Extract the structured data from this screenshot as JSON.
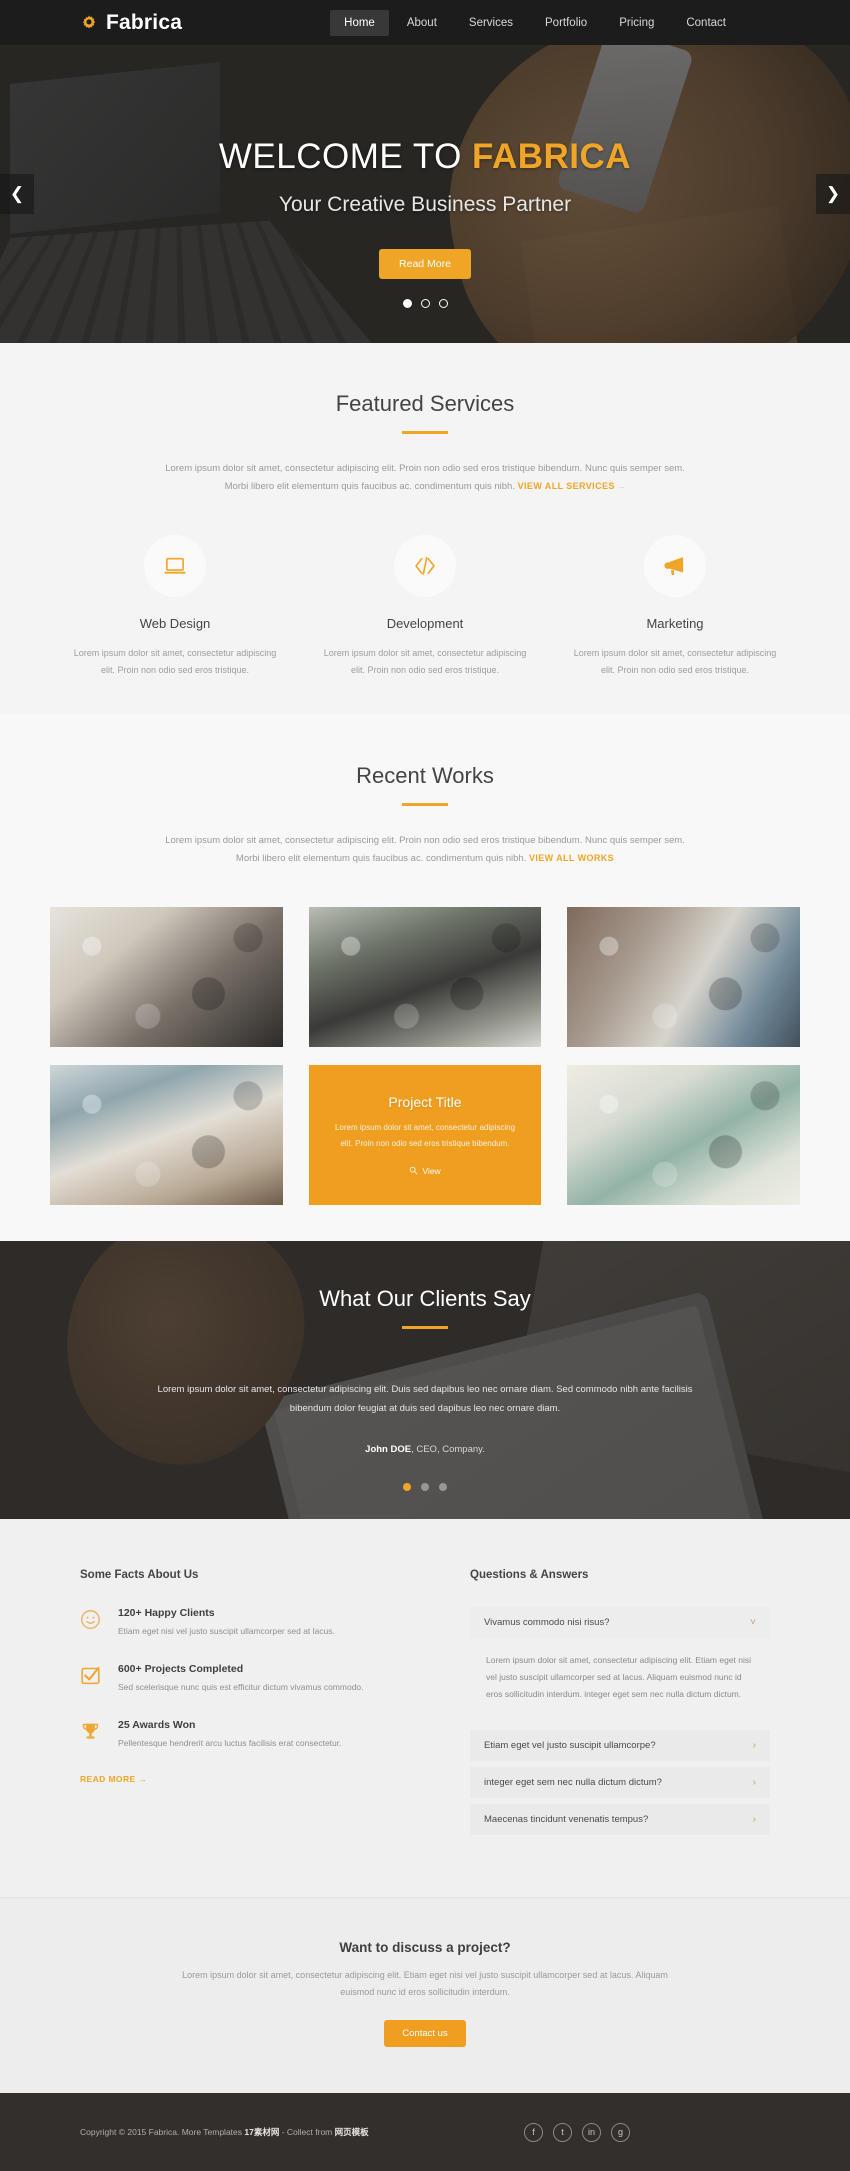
{
  "header": {
    "brand": "Fabrica",
    "brand_icon": "gear-icon",
    "nav": [
      {
        "label": "Home",
        "active": true
      },
      {
        "label": "About",
        "active": false
      },
      {
        "label": "Services",
        "active": false
      },
      {
        "label": "Portfolio",
        "active": false
      },
      {
        "label": "Pricing",
        "active": false
      },
      {
        "label": "Contact",
        "active": false
      }
    ]
  },
  "hero": {
    "title_main": "WELCOME TO ",
    "title_accent": "FABRICA",
    "subtitle": "Your Creative Business Partner",
    "button": "Read More",
    "prev_icon": "chevron-left-icon",
    "next_icon": "chevron-right-icon",
    "slide_count": 3,
    "active_slide": 1
  },
  "services": {
    "title": "Featured Services",
    "description": "Lorem ipsum dolor sit amet, consectetur adipiscing elit. Proin non odio sed eros tristique bibendum. Nunc quis semper sem. Morbi libero elit elementum quis faucibus ac. condimentum quis nibh. ",
    "link": "VIEW ALL SERVICES",
    "link_arrow": "→",
    "items": [
      {
        "icon": "laptop-icon",
        "name": "Web Design",
        "desc": "Lorem ipsum dolor sit amet, consectetur adipiscing elit. Proin non odio sed eros tristique."
      },
      {
        "icon": "code-icon",
        "name": "Development",
        "desc": "Lorem ipsum dolor sit amet, consectetur adipiscing elit. Proin non odio sed eros tristique."
      },
      {
        "icon": "megaphone-icon",
        "name": "Marketing",
        "desc": "Lorem ipsum dolor sit amet, consectetur adipiscing elit. Proin non odio sed eros tristique."
      }
    ]
  },
  "works": {
    "title": "Recent Works",
    "description": "Lorem ipsum dolor sit amet, consectetur adipiscing elit. Proin non odio sed eros tristique bibendum. Nunc quis semper sem. Morbi libero elit elementum quis faucibus ac. condimentum quis nibh. ",
    "link": "VIEW ALL WORKS",
    "featured": {
      "title": "Project Title",
      "desc": "Lorem ipsum dolor sit amet, consectetur adipiscing elit. Proin non odio sed eros tristique bibendum.",
      "view_label": "View",
      "view_icon": "magnifier-icon"
    }
  },
  "testimonials": {
    "title": "What Our Clients Say",
    "quote": "Lorem ipsum dolor sit amet, consectetur adipiscing elit. Duis sed dapibus leo nec ornare diam. Sed commodo nibh ante facilisis bibendum dolor feugiat at duis sed dapibus leo nec ornare diam.",
    "author_name": "John DOE",
    "author_role": ", CEO, Company.",
    "slide_count": 3,
    "active_slide": 1
  },
  "facts": {
    "title": "Some Facts About Us",
    "items": [
      {
        "icon": "smiley-icon",
        "name": "120+ Happy Clients",
        "desc": "Etiam eget nisi vel justo suscipit ullamcorper sed at lacus."
      },
      {
        "icon": "check-square-icon",
        "name": "600+ Projects Completed",
        "desc": "Sed scelerisque nunc quis est efficitur dictum vivamus commodo."
      },
      {
        "icon": "trophy-icon",
        "name": "25 Awards Won",
        "desc": "Pellentesque hendrerit arcu luctus facilisis erat consectetur."
      }
    ],
    "read_more": "READ MORE",
    "read_more_arrow": "→"
  },
  "faq": {
    "title": "Questions & Answers",
    "items": [
      {
        "question": "Vivamus commodo nisi risus?",
        "answer": "Lorem ipsum dolor sit amet, consectetur adipiscing elit. Etiam eget nisi vel justo suscipit ullamcorper sed at lacus. Aliquam euismod nunc id eros sollicitudin interdum. integer eget sem nec nulla dictum dictum.",
        "open": true
      },
      {
        "question": "Etiam eget vel justo suscipit ullamcorpe?",
        "answer": "",
        "open": false
      },
      {
        "question": "integer eget sem nec nulla dictum dictum?",
        "answer": "",
        "open": false
      },
      {
        "question": "Maecenas tincidunt venenatis tempus?",
        "answer": "",
        "open": false
      }
    ]
  },
  "cta": {
    "title": "Want to discuss a project?",
    "desc": "Lorem ipsum dolor sit amet, consectetur adipiscing elit. Etiam eget nisi vel justo suscipit ullamcorper sed at lacus. Aliquam euismod nunc id eros sollicitudin interdum.",
    "button": "Contact us"
  },
  "footer": {
    "copyright_pre": "Copyright © 2015 Fabrica. More Templates ",
    "copyright_link": "17素材网",
    "copyright_mid": " - Collect from ",
    "copyright_link2": "网页模板",
    "socials": [
      {
        "icon": "facebook-icon",
        "glyph": "f"
      },
      {
        "icon": "twitter-icon",
        "glyph": "t"
      },
      {
        "icon": "linkedin-icon",
        "glyph": "in"
      },
      {
        "icon": "google-plus-icon",
        "glyph": "g"
      }
    ]
  },
  "colors": {
    "accent": "#f0a526",
    "featured_tile": "#ef9e20",
    "header_bg": "#1c1c1c",
    "footer_bg": "#332f2c"
  }
}
